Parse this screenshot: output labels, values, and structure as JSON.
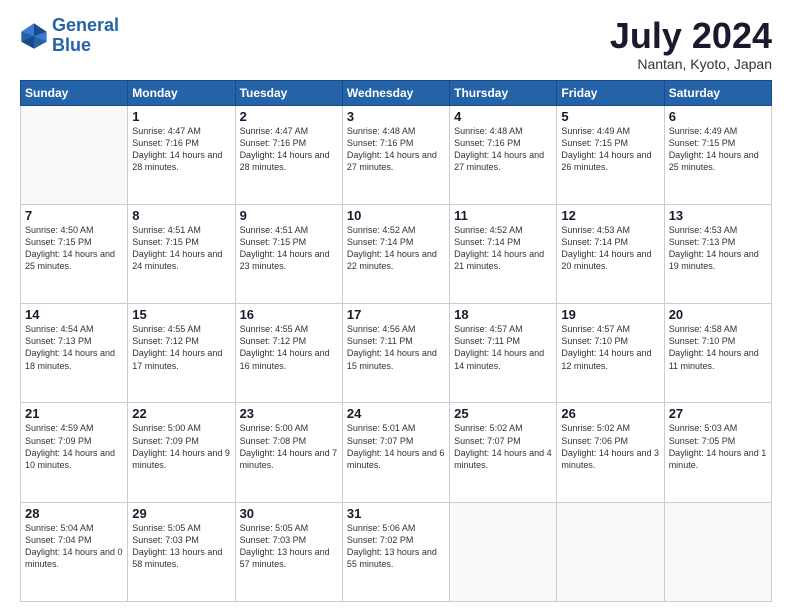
{
  "header": {
    "logo_line1": "General",
    "logo_line2": "Blue",
    "month": "July 2024",
    "location": "Nantan, Kyoto, Japan"
  },
  "weekdays": [
    "Sunday",
    "Monday",
    "Tuesday",
    "Wednesday",
    "Thursday",
    "Friday",
    "Saturday"
  ],
  "weeks": [
    [
      {
        "day": "",
        "info": ""
      },
      {
        "day": "1",
        "info": "Sunrise: 4:47 AM\nSunset: 7:16 PM\nDaylight: 14 hours\nand 28 minutes."
      },
      {
        "day": "2",
        "info": "Sunrise: 4:47 AM\nSunset: 7:16 PM\nDaylight: 14 hours\nand 28 minutes."
      },
      {
        "day": "3",
        "info": "Sunrise: 4:48 AM\nSunset: 7:16 PM\nDaylight: 14 hours\nand 27 minutes."
      },
      {
        "day": "4",
        "info": "Sunrise: 4:48 AM\nSunset: 7:16 PM\nDaylight: 14 hours\nand 27 minutes."
      },
      {
        "day": "5",
        "info": "Sunrise: 4:49 AM\nSunset: 7:15 PM\nDaylight: 14 hours\nand 26 minutes."
      },
      {
        "day": "6",
        "info": "Sunrise: 4:49 AM\nSunset: 7:15 PM\nDaylight: 14 hours\nand 25 minutes."
      }
    ],
    [
      {
        "day": "7",
        "info": "Sunrise: 4:50 AM\nSunset: 7:15 PM\nDaylight: 14 hours\nand 25 minutes."
      },
      {
        "day": "8",
        "info": "Sunrise: 4:51 AM\nSunset: 7:15 PM\nDaylight: 14 hours\nand 24 minutes."
      },
      {
        "day": "9",
        "info": "Sunrise: 4:51 AM\nSunset: 7:15 PM\nDaylight: 14 hours\nand 23 minutes."
      },
      {
        "day": "10",
        "info": "Sunrise: 4:52 AM\nSunset: 7:14 PM\nDaylight: 14 hours\nand 22 minutes."
      },
      {
        "day": "11",
        "info": "Sunrise: 4:52 AM\nSunset: 7:14 PM\nDaylight: 14 hours\nand 21 minutes."
      },
      {
        "day": "12",
        "info": "Sunrise: 4:53 AM\nSunset: 7:14 PM\nDaylight: 14 hours\nand 20 minutes."
      },
      {
        "day": "13",
        "info": "Sunrise: 4:53 AM\nSunset: 7:13 PM\nDaylight: 14 hours\nand 19 minutes."
      }
    ],
    [
      {
        "day": "14",
        "info": "Sunrise: 4:54 AM\nSunset: 7:13 PM\nDaylight: 14 hours\nand 18 minutes."
      },
      {
        "day": "15",
        "info": "Sunrise: 4:55 AM\nSunset: 7:12 PM\nDaylight: 14 hours\nand 17 minutes."
      },
      {
        "day": "16",
        "info": "Sunrise: 4:55 AM\nSunset: 7:12 PM\nDaylight: 14 hours\nand 16 minutes."
      },
      {
        "day": "17",
        "info": "Sunrise: 4:56 AM\nSunset: 7:11 PM\nDaylight: 14 hours\nand 15 minutes."
      },
      {
        "day": "18",
        "info": "Sunrise: 4:57 AM\nSunset: 7:11 PM\nDaylight: 14 hours\nand 14 minutes."
      },
      {
        "day": "19",
        "info": "Sunrise: 4:57 AM\nSunset: 7:10 PM\nDaylight: 14 hours\nand 12 minutes."
      },
      {
        "day": "20",
        "info": "Sunrise: 4:58 AM\nSunset: 7:10 PM\nDaylight: 14 hours\nand 11 minutes."
      }
    ],
    [
      {
        "day": "21",
        "info": "Sunrise: 4:59 AM\nSunset: 7:09 PM\nDaylight: 14 hours\nand 10 minutes."
      },
      {
        "day": "22",
        "info": "Sunrise: 5:00 AM\nSunset: 7:09 PM\nDaylight: 14 hours\nand 9 minutes."
      },
      {
        "day": "23",
        "info": "Sunrise: 5:00 AM\nSunset: 7:08 PM\nDaylight: 14 hours\nand 7 minutes."
      },
      {
        "day": "24",
        "info": "Sunrise: 5:01 AM\nSunset: 7:07 PM\nDaylight: 14 hours\nand 6 minutes."
      },
      {
        "day": "25",
        "info": "Sunrise: 5:02 AM\nSunset: 7:07 PM\nDaylight: 14 hours\nand 4 minutes."
      },
      {
        "day": "26",
        "info": "Sunrise: 5:02 AM\nSunset: 7:06 PM\nDaylight: 14 hours\nand 3 minutes."
      },
      {
        "day": "27",
        "info": "Sunrise: 5:03 AM\nSunset: 7:05 PM\nDaylight: 14 hours\nand 1 minute."
      }
    ],
    [
      {
        "day": "28",
        "info": "Sunrise: 5:04 AM\nSunset: 7:04 PM\nDaylight: 14 hours\nand 0 minutes."
      },
      {
        "day": "29",
        "info": "Sunrise: 5:05 AM\nSunset: 7:03 PM\nDaylight: 13 hours\nand 58 minutes."
      },
      {
        "day": "30",
        "info": "Sunrise: 5:05 AM\nSunset: 7:03 PM\nDaylight: 13 hours\nand 57 minutes."
      },
      {
        "day": "31",
        "info": "Sunrise: 5:06 AM\nSunset: 7:02 PM\nDaylight: 13 hours\nand 55 minutes."
      },
      {
        "day": "",
        "info": ""
      },
      {
        "day": "",
        "info": ""
      },
      {
        "day": "",
        "info": ""
      }
    ]
  ]
}
